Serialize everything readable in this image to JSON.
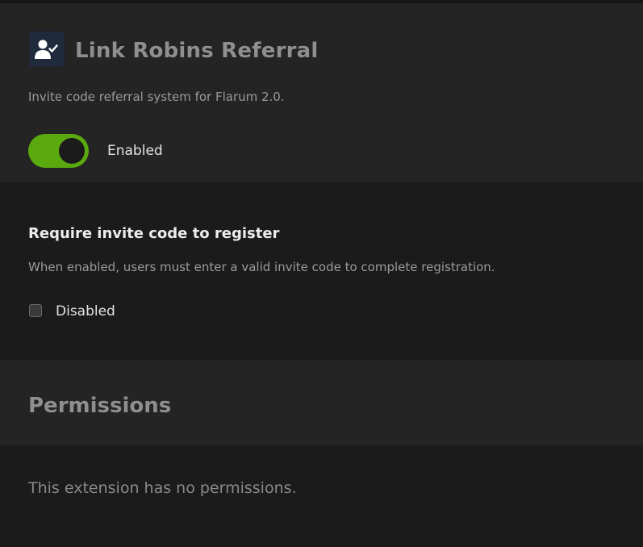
{
  "extension": {
    "title": "Link Robins Referral",
    "icon": "user-check-icon",
    "icon_bg": "#1f2a3c",
    "description": "Invite code referral system for Flarum 2.0.",
    "enabled_toggle": {
      "state": true,
      "label": "Enabled",
      "color": "#5aa90e"
    }
  },
  "settings": {
    "require_invite": {
      "title": "Require invite code to register",
      "help": "When enabled, users must enter a valid invite code to complete registration.",
      "checked": false,
      "label": "Disabled"
    }
  },
  "permissions": {
    "title": "Permissions",
    "empty_text": "This extension has no permissions."
  }
}
